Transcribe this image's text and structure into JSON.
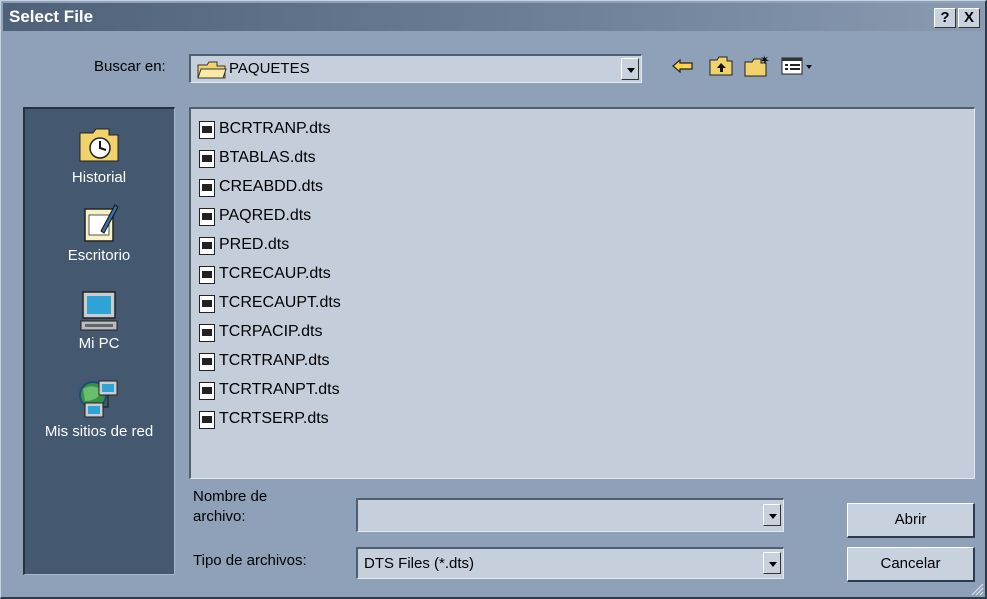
{
  "title": "Select File",
  "titlebar_buttons": {
    "help": "?",
    "close": "X"
  },
  "look_in": {
    "label": "Buscar en:",
    "value": "PAQUETES",
    "folder_icon": "folder-open-icon"
  },
  "toolbar_icons": [
    "back-arrow-icon",
    "up-folder-icon",
    "new-folder-icon",
    "view-menu-icon"
  ],
  "places": [
    {
      "label": "Historial",
      "icon": "history-icon"
    },
    {
      "label": "Escritorio",
      "icon": "desktop-icon"
    },
    {
      "label": "Mi PC",
      "icon": "my-computer-icon"
    },
    {
      "label": "Mis sitios de red",
      "icon": "network-places-icon"
    }
  ],
  "files": [
    "BCRTRANP.dts",
    "BTABLAS.dts",
    "CREABDD.dts",
    "PAQRED.dts",
    "PRED.dts",
    "TCRECAUP.dts",
    "TCRECAUPT.dts",
    "TCRPACIP.dts",
    "TCRTRANP.dts",
    "TCRTRANPT.dts",
    "TCRTSERP.dts"
  ],
  "filename": {
    "label_line1": "Nombre de",
    "label_line2": "archivo:",
    "value": ""
  },
  "filetype": {
    "label": "Tipo de archivos:",
    "value": "DTS Files (*.dts)"
  },
  "buttons": {
    "open": "Abrir",
    "cancel": "Cancelar"
  },
  "colors": {
    "dialog_bg": "#8fa1b8",
    "places_bg": "#44586f",
    "list_bg": "#c4cedb",
    "folder_yellow": "#f2d36b"
  }
}
